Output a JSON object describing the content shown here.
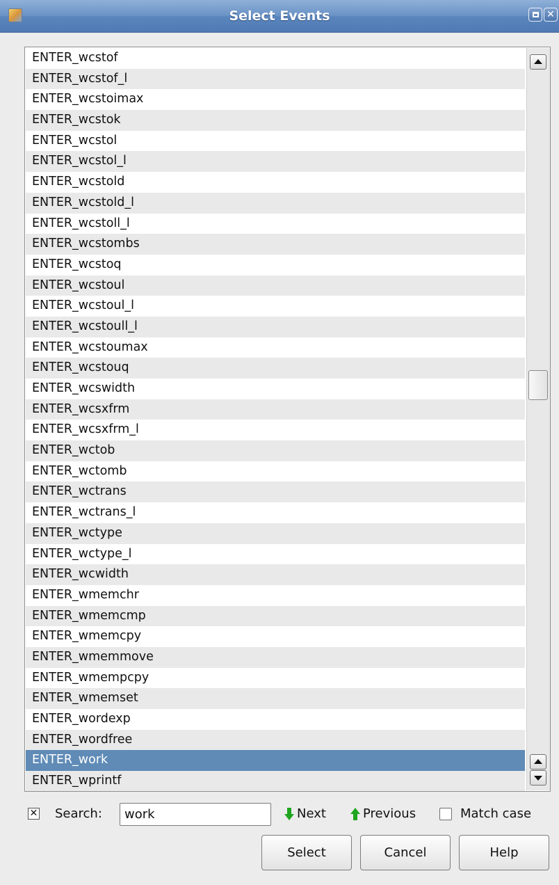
{
  "window": {
    "title": "Select Events"
  },
  "events": {
    "items": [
      "ENTER_wcstof",
      "ENTER_wcstof_l",
      "ENTER_wcstoimax",
      "ENTER_wcstok",
      "ENTER_wcstol",
      "ENTER_wcstol_l",
      "ENTER_wcstold",
      "ENTER_wcstold_l",
      "ENTER_wcstoll_l",
      "ENTER_wcstombs",
      "ENTER_wcstoq",
      "ENTER_wcstoul",
      "ENTER_wcstoul_l",
      "ENTER_wcstoull_l",
      "ENTER_wcstoumax",
      "ENTER_wcstouq",
      "ENTER_wcswidth",
      "ENTER_wcsxfrm",
      "ENTER_wcsxfrm_l",
      "ENTER_wctob",
      "ENTER_wctomb",
      "ENTER_wctrans",
      "ENTER_wctrans_l",
      "ENTER_wctype",
      "ENTER_wctype_l",
      "ENTER_wcwidth",
      "ENTER_wmemchr",
      "ENTER_wmemcmp",
      "ENTER_wmemcpy",
      "ENTER_wmemmove",
      "ENTER_wmempcpy",
      "ENTER_wmemset",
      "ENTER_wordexp",
      "ENTER_wordfree",
      "ENTER_work",
      "ENTER_wprintf"
    ],
    "selected_index": 34
  },
  "search": {
    "enabled": true,
    "label": "Search:",
    "value": "work",
    "next_label": "Next",
    "previous_label": "Previous",
    "match_case_label": "Match case",
    "match_case_checked": false
  },
  "buttons": {
    "select": "Select",
    "cancel": "Cancel",
    "help": "Help"
  },
  "colors": {
    "selection": "#5f8bb6",
    "titlebar": "#6b93c6",
    "arrow_green": "#1fa51f"
  }
}
